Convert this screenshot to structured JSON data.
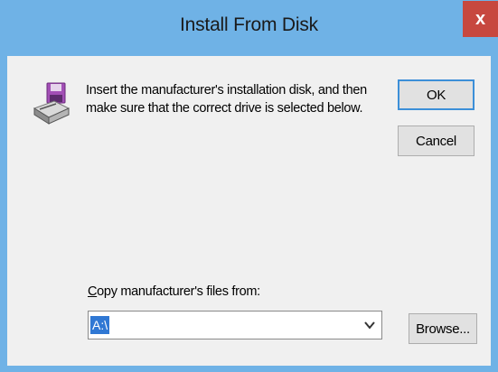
{
  "window": {
    "title": "Install From Disk",
    "close_label": "x"
  },
  "dialog": {
    "message_line1": "Insert the manufacturer's installation disk, and then",
    "message_line2": "make sure that the correct drive is selected below.",
    "ok_label": "OK",
    "cancel_label": "Cancel",
    "copy_label_underlined": "C",
    "copy_label_rest": "opy manufacturer's files from:",
    "path_value": "A:\\",
    "browse_label": "Browse..."
  },
  "icons": {
    "disk": "floppy-disk-drive-icon",
    "dropdown": "chevron-down-icon"
  },
  "colors": {
    "titlebar": "#6fb2e6",
    "close": "#c7483f",
    "selection": "#3078d4",
    "client": "#f0f0f0"
  }
}
